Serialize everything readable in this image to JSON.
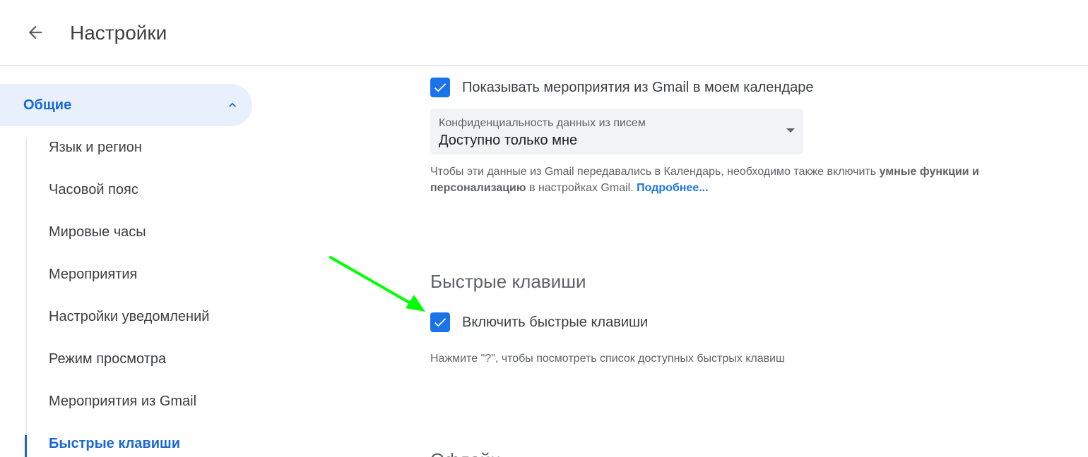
{
  "header": {
    "title": "Настройки",
    "back_icon": "arrow-back-icon"
  },
  "sidebar": {
    "section": {
      "label": "Общие",
      "expanded": true,
      "icon": "chevron-up-icon"
    },
    "items": [
      {
        "label": "Язык и регион"
      },
      {
        "label": "Часовой пояс"
      },
      {
        "label": "Мировые часы"
      },
      {
        "label": "Мероприятия"
      },
      {
        "label": "Настройки уведомлений"
      },
      {
        "label": "Режим просмотра"
      },
      {
        "label": "Мероприятия из Gmail"
      },
      {
        "label": "Быстрые клавиши",
        "active": true
      }
    ]
  },
  "main": {
    "gmail_events": {
      "checkbox_label": "Показывать мероприятия из Gmail в моем календаре",
      "checked": true,
      "privacy_select": {
        "label": "Конфиденциальность данных из писем",
        "value": "Доступно только мне"
      },
      "help": {
        "part1": "Чтобы эти данные из Gmail передавались в Календарь, необходимо также включить ",
        "bold": "умные функции и персонализацию",
        "part2": " в настройках Gmail. ",
        "link": "Подробнее..."
      }
    },
    "shortcuts": {
      "title": "Быстрые клавиши",
      "checkbox_label": "Включить быстрые клавиши",
      "checked": true,
      "hint": "Нажмите \"?\", чтобы посмотреть список доступных быстрых клавиш"
    },
    "next_section_title": "Офлайн"
  },
  "annotation": {
    "arrow_color": "#00ff00"
  },
  "colors": {
    "accent": "#1a73e8",
    "active_text": "#1967d2",
    "active_bg": "#e8f0fe"
  }
}
